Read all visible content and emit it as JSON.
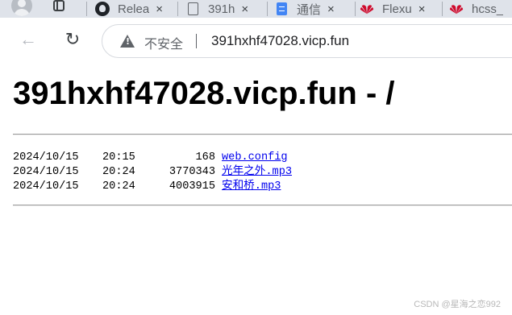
{
  "tabs": [
    {
      "title": "Relea",
      "icon": "github-icon"
    },
    {
      "title": "391h",
      "icon": "page-icon"
    },
    {
      "title": "通信",
      "icon": "docs-icon"
    },
    {
      "title": "Flexu",
      "icon": "huawei-icon"
    },
    {
      "title": "hcss_",
      "icon": "huawei-icon"
    }
  ],
  "tab_close_glyph": "×",
  "toolbar": {
    "back_glyph": "←",
    "reload_glyph": "↻",
    "security_label": "不安全",
    "url": "391hxhf47028.vicp.fun"
  },
  "page": {
    "title": "391hxhf47028.vicp.fun - /",
    "files": [
      {
        "date": "2024/10/15",
        "time": "20:15",
        "size": "168",
        "name": "web.config"
      },
      {
        "date": "2024/10/15",
        "time": "20:24",
        "size": "3770343",
        "name": "光年之外.mp3"
      },
      {
        "date": "2024/10/15",
        "time": "20:24",
        "size": "4003915",
        "name": "安和桥.mp3"
      }
    ]
  },
  "watermark": "CSDN @星海之恋992",
  "colors": {
    "tabstrip_bg": "#dfe3ea",
    "link": "#0000ee",
    "huawei_red": "#cf0a2c"
  }
}
